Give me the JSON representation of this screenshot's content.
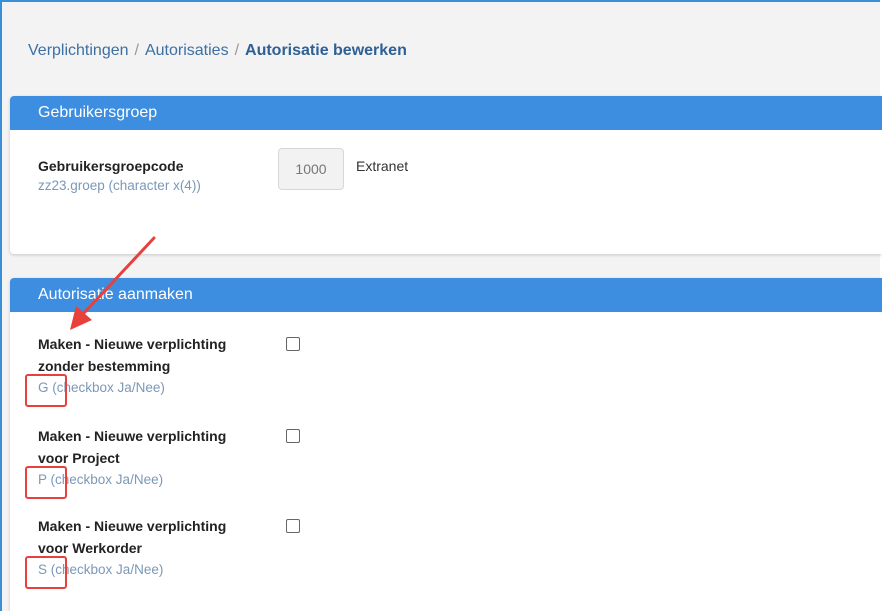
{
  "breadcrumb": {
    "items": [
      "Verplichtingen",
      "Autorisaties"
    ],
    "separator": "/",
    "current": "Autorisatie bewerken"
  },
  "group_section": {
    "title": "Gebruikersgroep",
    "field_label": "Gebruikersgroepcode",
    "field_sub": "zz23.groep (character x(4))",
    "code_value": "1000",
    "code_description": "Extranet"
  },
  "auth_section": {
    "title": "Autorisatie aanmaken",
    "items": [
      {
        "label_line1": "Maken - Nieuwe verplichting",
        "label_line2": "zonder bestemming",
        "code": "G",
        "type": "(checkbox Ja/Nee)",
        "checked": false
      },
      {
        "label_line1": "Maken - Nieuwe verplichting",
        "label_line2": "voor Project",
        "code": "P",
        "type": "(checkbox Ja/Nee)",
        "checked": false
      },
      {
        "label_line1": "Maken - Nieuwe verplichting",
        "label_line2": "voor Werkorder",
        "code": "S",
        "type": "(checkbox Ja/Nee)",
        "checked": false
      }
    ]
  },
  "annotation": {
    "color": "#e8413c"
  },
  "colors": {
    "header_blue": "#3d8ee0",
    "frame_blue": "#3a8fd9",
    "link_blue": "#3d6fa3"
  }
}
